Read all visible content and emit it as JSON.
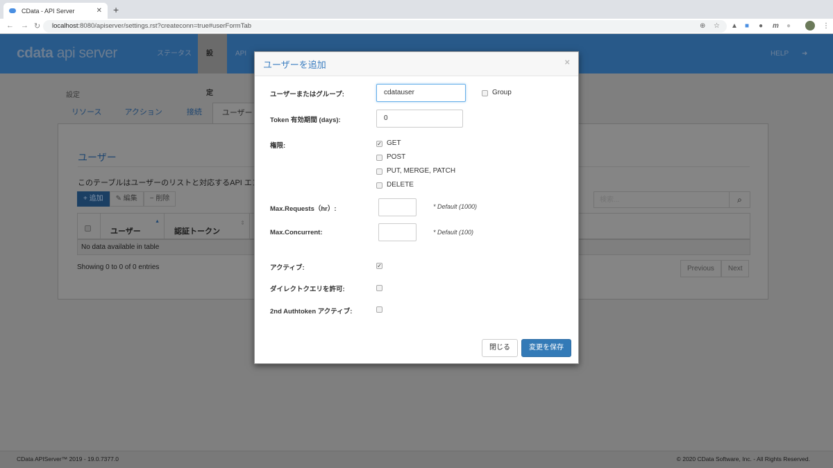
{
  "browser": {
    "tab_title": "CData - API Server",
    "url_host": "localhost",
    "url_rest": ":8080/apiserver/settings.rst?createconn=true#userFormTab"
  },
  "header": {
    "logo_a": "cdata",
    "logo_b": " api server",
    "nav": [
      "ステータス",
      "設定",
      "API"
    ],
    "help": "HELP"
  },
  "page": {
    "breadcrumb": "設定",
    "tabs": [
      "リソース",
      "アクション",
      "接続",
      "ユーザー"
    ],
    "title": "ユーザー",
    "description": "このテーブルはユーザーのリストと対応するAPI エンドポ",
    "buttons": {
      "add": "+ 追加",
      "edit": "✎ 編集",
      "delete": "− 削除"
    },
    "search_placeholder": "検索...",
    "columns": [
      "ユーザー",
      "認証トークン"
    ],
    "empty": "No data available in table",
    "info": "Showing 0 to 0 of 0 entries",
    "prev": "Previous",
    "next": "Next"
  },
  "footer": {
    "left": "CData APIServer™ 2019 - 19.0.7377.0",
    "right": "© 2020 CData Software, Inc. - All Rights Reserved."
  },
  "modal": {
    "title": "ユーザーを追加",
    "user_label": "ユーザーまたはグループ:",
    "user_value": "cdatauser",
    "group_label": "Group",
    "token_label": "Token 有効期間 (days):",
    "token_value": "0",
    "perm_label": "権限:",
    "perms": [
      {
        "label": "GET",
        "checked": true
      },
      {
        "label": "POST",
        "checked": false
      },
      {
        "label": "PUT, MERGE, PATCH",
        "checked": false
      },
      {
        "label": "DELETE",
        "checked": false
      }
    ],
    "maxreq_label": "Max.Requests（hr）:",
    "maxreq_hint": "* Default (1000)",
    "maxcon_label": "Max.Concurrent:",
    "maxcon_hint": "* Default (100)",
    "active_label": "アクティブ:",
    "direct_label": "ダイレクトクエリを許可:",
    "auth2_label": "2nd Authtoken アクティブ:",
    "close": "閉じる",
    "save": "変更を保存"
  }
}
